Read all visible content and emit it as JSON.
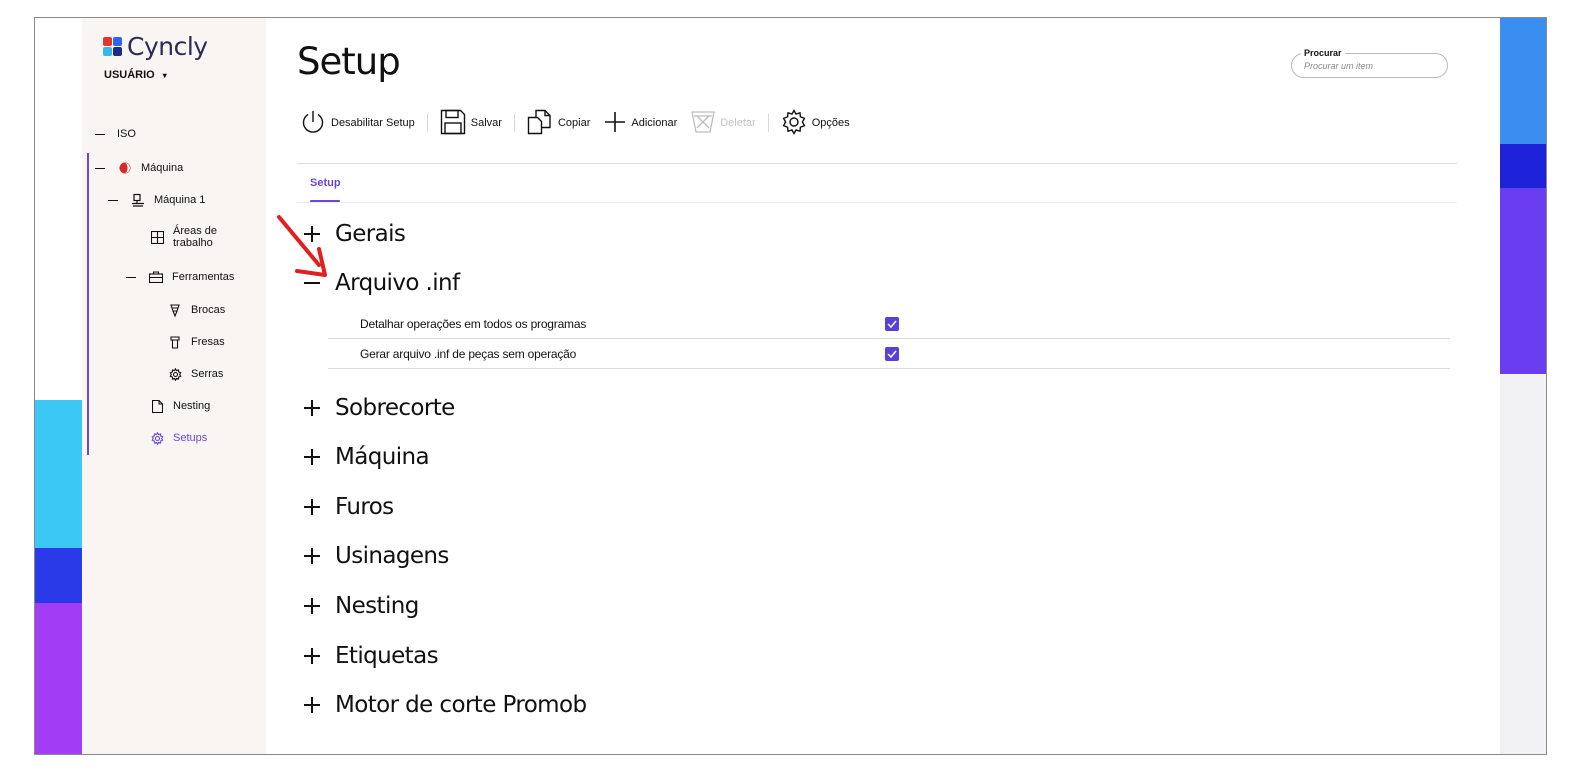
{
  "brand": {
    "name": "Cyncly",
    "colors": [
      "#e3342f",
      "#2a66f0",
      "#1f2a8a",
      "#37b8e8"
    ]
  },
  "user": {
    "label": "USUÁRIO",
    "caret": "▾"
  },
  "sidebar": {
    "items": [
      {
        "label": "ISO",
        "icon": "dash"
      },
      {
        "label": "Máquina",
        "icon": "machine-logo-icon"
      },
      {
        "label": "Máquina 1",
        "icon": "machine-icon"
      },
      {
        "label": "Áreas de trabalho",
        "icon": "grid-icon"
      },
      {
        "label": "Ferramentas",
        "icon": "toolbox-icon"
      },
      {
        "label": "Brocas",
        "icon": "drill-bit-icon"
      },
      {
        "label": "Fresas",
        "icon": "router-bit-icon"
      },
      {
        "label": "Serras",
        "icon": "saw-icon"
      },
      {
        "label": "Nesting",
        "icon": "document-icon"
      },
      {
        "label": "Setups",
        "icon": "gear-icon"
      }
    ]
  },
  "page": {
    "title": "Setup"
  },
  "search": {
    "label": "Procurar",
    "placeholder": "Procurar um item"
  },
  "toolbar": {
    "disable_setup": "Desabilitar Setup",
    "save": "Salvar",
    "copy": "Copiar",
    "add": "Adicionar",
    "delete": "Deletar",
    "options": "Opções"
  },
  "tabs": [
    {
      "label": "Setup",
      "active": true
    }
  ],
  "sections": [
    {
      "title": "Gerais",
      "expanded": false
    },
    {
      "title": "Arquivo .inf",
      "expanded": true,
      "options": [
        {
          "label": "Detalhar operações em todos os programas",
          "checked": true
        },
        {
          "label": "Gerar arquivo .inf de peças sem operação",
          "checked": true
        }
      ]
    },
    {
      "title": "Sobrecorte",
      "expanded": false
    },
    {
      "title": "Máquina",
      "expanded": false
    },
    {
      "title": "Furos",
      "expanded": false
    },
    {
      "title": "Usinagens",
      "expanded": false
    },
    {
      "title": "Nesting",
      "expanded": false
    },
    {
      "title": "Etiquetas",
      "expanded": false
    },
    {
      "title": "Motor de corte Promob",
      "expanded": false
    }
  ],
  "accent_color": "#6b47d8",
  "annotation_color": "#e0201f"
}
